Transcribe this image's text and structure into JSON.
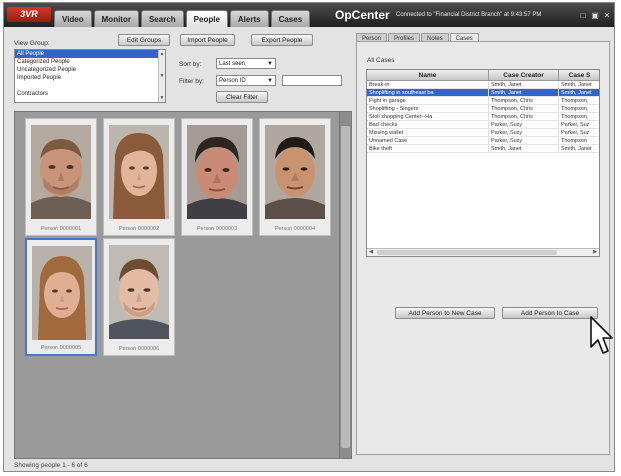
{
  "app": {
    "logo": "3VR",
    "title": "OpCenter",
    "connection_status": "Connected to \"Financial District Branch\" at 9:43:57 PM",
    "window_controls": [
      "□",
      "▣",
      "✕"
    ]
  },
  "main_tabs": [
    {
      "label": "Video",
      "active": false
    },
    {
      "label": "Monitor",
      "active": false
    },
    {
      "label": "Search",
      "active": false
    },
    {
      "label": "People",
      "active": true
    },
    {
      "label": "Alerts",
      "active": false
    },
    {
      "label": "Cases",
      "active": false
    }
  ],
  "left": {
    "view_group_label": "View Group:",
    "edit_groups_label": "Edit Groups",
    "import_people_label": "Import People",
    "export_people_label": "Export People",
    "groups": [
      {
        "label": "All People",
        "selected": true
      },
      {
        "label": "Categorized People",
        "selected": false
      },
      {
        "label": "Uncategorized People",
        "selected": false
      },
      {
        "label": "Imported People",
        "selected": false
      },
      {
        "label": "",
        "selected": false
      },
      {
        "label": "Contractors",
        "selected": false
      }
    ],
    "sort_by_label": "Sort by:",
    "sort_by_value": "Last seen",
    "filter_by_label": "Filter by:",
    "filter_by_value": "Person ID",
    "filter_text": "",
    "clear_filter_label": "Clear Filter",
    "status": "Showing people 1 - 6 of 6"
  },
  "people": [
    {
      "caption": "Person 0000001",
      "selected": false
    },
    {
      "caption": "Person 0000002",
      "selected": false
    },
    {
      "caption": "Person 0000003",
      "selected": false
    },
    {
      "caption": "Person 0000004",
      "selected": false
    },
    {
      "caption": "Person 0000005",
      "selected": true
    },
    {
      "caption": "Person 0000006",
      "selected": false
    }
  ],
  "right": {
    "tabs": [
      {
        "label": "Person",
        "active": false
      },
      {
        "label": "Profiles",
        "active": false
      },
      {
        "label": "Notes",
        "active": false
      },
      {
        "label": "Cases",
        "active": true
      }
    ],
    "all_cases_label": "All Cases",
    "columns": [
      "Name",
      "Case Creator",
      "Case S"
    ],
    "cases": [
      {
        "name": "Break-in",
        "creator": "Smith, Janet",
        "third": "Smith, Janet",
        "selected": false
      },
      {
        "name": "Shoplifting in southeast ba",
        "creator": "Smith, Janet",
        "third": "Smith, Janet",
        "selected": true
      },
      {
        "name": "Fight in garage",
        "creator": "Thompson, Chris",
        "third": "Thompson,",
        "selected": false
      },
      {
        "name": "Shoplifting - Singers",
        "creator": "Thompson, Chris",
        "third": "Thompson,",
        "selected": false
      },
      {
        "name": "Stoll shopping Center--Ha",
        "creator": "Thompson, Chris",
        "third": "Thompson,",
        "selected": false
      },
      {
        "name": "Bad checks",
        "creator": "Parker, Suzy",
        "third": "Parker, Suz",
        "selected": false
      },
      {
        "name": "Missing wallet",
        "creator": "Parker, Suzy",
        "third": "Parker, Suz",
        "selected": false
      },
      {
        "name": "Unnamed Case",
        "creator": "Parker, Suzy",
        "third": "Thompson",
        "selected": false
      },
      {
        "name": "Bike theft",
        "creator": "Smith, Janet",
        "third": "Smith, Janet",
        "selected": false
      }
    ],
    "add_new_case_label": "Add Person to New Case",
    "add_to_case_label": "Add Person to Case"
  }
}
